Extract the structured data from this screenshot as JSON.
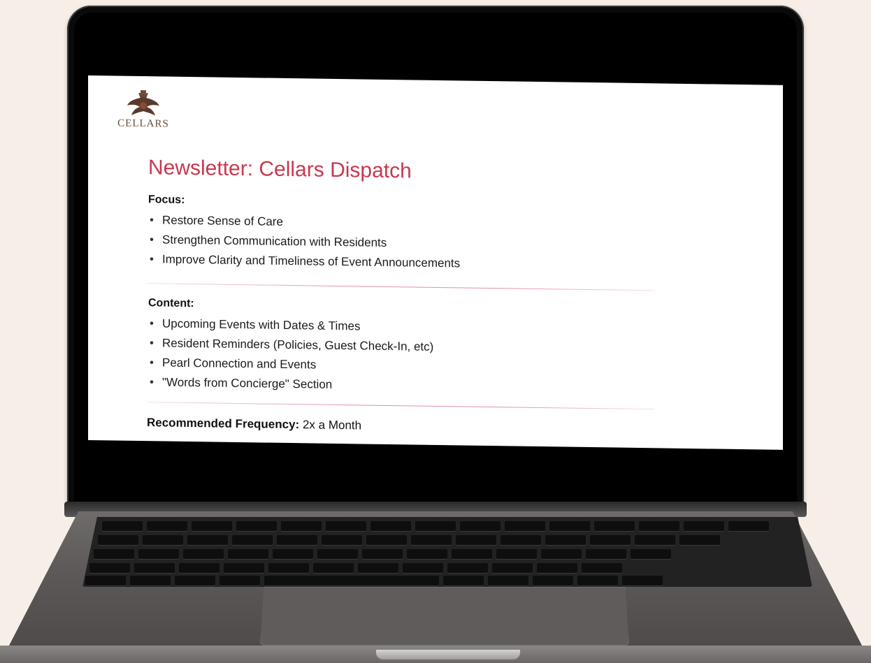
{
  "slide": {
    "logo_text": "CELLARS",
    "title": "Newsletter: Cellars Dispatch",
    "focus": {
      "heading": "Focus:",
      "items": [
        "Restore Sense of Care",
        "Strengthen Communication with Residents",
        "Improve Clarity and Timeliness of Event Announcements"
      ]
    },
    "content": {
      "heading": "Content:",
      "items": [
        "Upcoming Events with Dates & Times",
        "Resident Reminders (Policies, Guest Check-In, etc)",
        "Pearl Connection and Events",
        "\"Words from Concierge\" Section"
      ]
    },
    "frequency": {
      "label": "Recommended Frequency:",
      "value": "2x a Month"
    }
  },
  "colors": {
    "title": "#c8384f",
    "divider": "#c8384f",
    "background": "#f7efe7",
    "logo": "#6b4a3a"
  },
  "icons": {
    "logo": "cellars-crest-icon"
  }
}
